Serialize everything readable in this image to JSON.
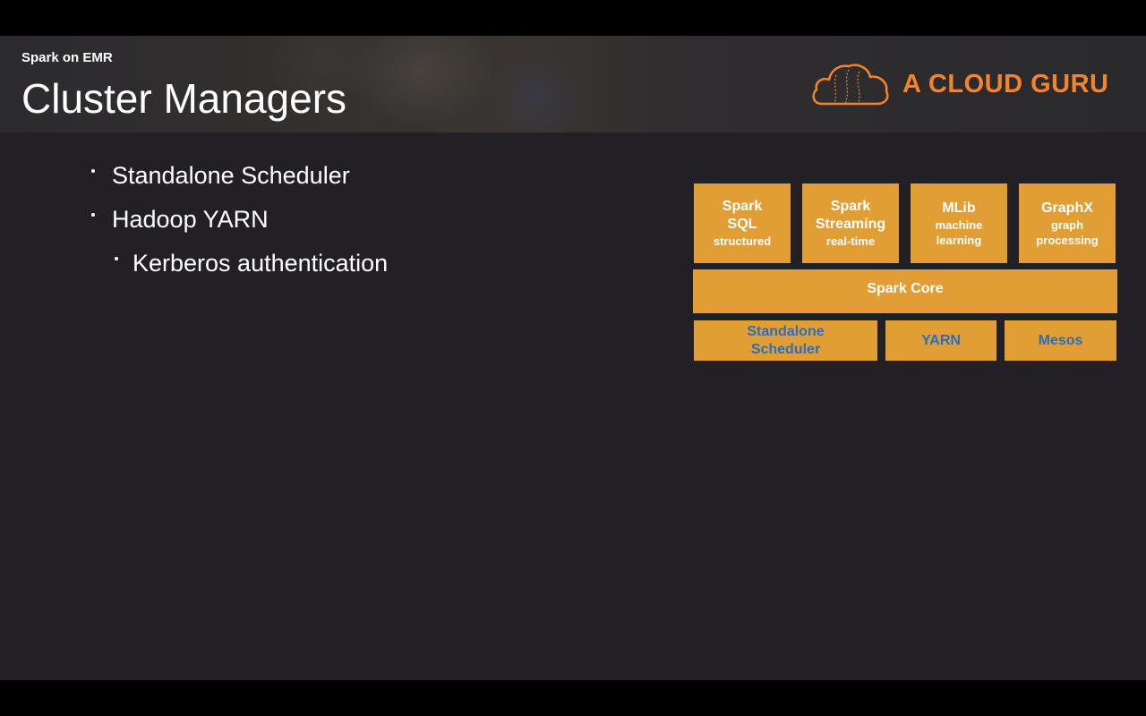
{
  "header": {
    "section": "Spark on EMR",
    "title": "Cluster Managers",
    "logo_text": "A CLOUD GURU",
    "logo_color": "#f5832a"
  },
  "bullets": [
    {
      "text": "Standalone Scheduler",
      "level": 1
    },
    {
      "text": "Hadoop YARN",
      "level": 1
    },
    {
      "text": "Kerberos authentication",
      "level": 2
    }
  ],
  "diagram": {
    "box_color": "#e09e35",
    "manager_text_color": "#2a6fb8",
    "libraries": [
      {
        "lines": [
          "Spark",
          "SQL"
        ],
        "sub": "structured"
      },
      {
        "lines": [
          "Spark",
          "Streaming"
        ],
        "sub": "real-time"
      },
      {
        "lines": [
          "MLib"
        ],
        "sub_lines": [
          "machine",
          "learning"
        ]
      },
      {
        "lines": [
          "GraphX"
        ],
        "sub_lines": [
          "graph",
          "processing"
        ]
      }
    ],
    "core": "Spark Core",
    "managers": [
      {
        "lines": [
          "Standalone",
          "Scheduler"
        ]
      },
      {
        "lines": [
          "YARN"
        ]
      },
      {
        "lines": [
          "Mesos"
        ]
      }
    ]
  }
}
